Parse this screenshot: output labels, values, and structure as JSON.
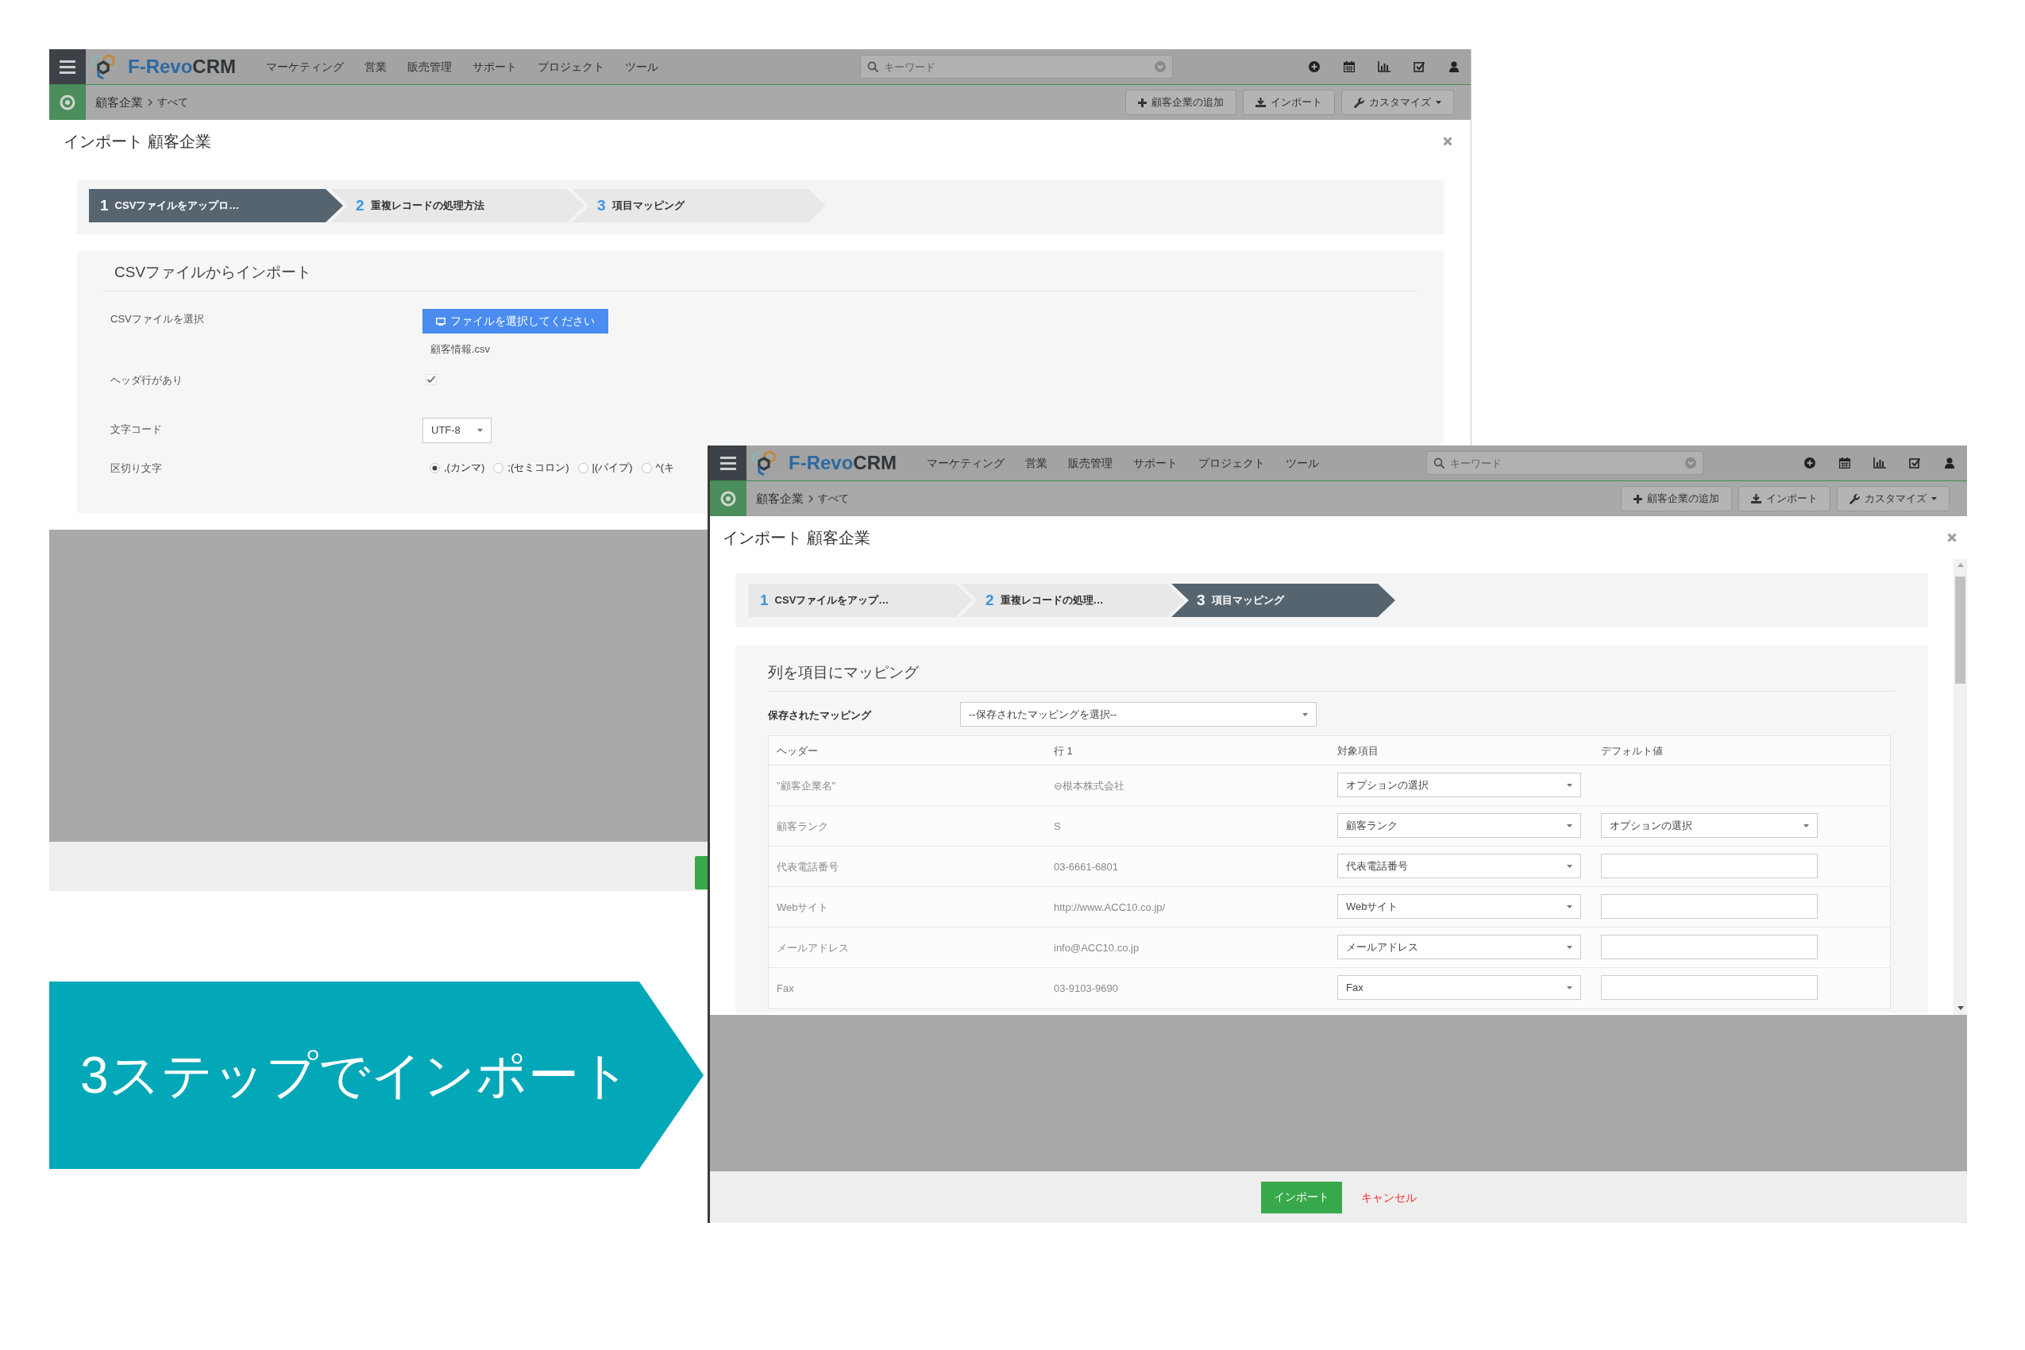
{
  "windows": [
    {
      "header": {
        "logo": {
          "brand": "F-Revo",
          "suffix": "CRM"
        },
        "menu": [
          "マーケティング",
          "営業",
          "販売管理",
          "サポート",
          "プロジェクト",
          "ツール"
        ],
        "search": {
          "placeholder": "キーワード"
        }
      },
      "breadcrumb": {
        "module": "顧客企業",
        "view": "すべて",
        "actions": [
          {
            "label": "顧客企業の追加",
            "dropdown": false
          },
          {
            "label": "インポート",
            "dropdown": false
          },
          {
            "label": "カスタマイズ",
            "dropdown": true
          }
        ]
      },
      "modal": {
        "kind": "upload",
        "title": "インポート 顧客企業",
        "steps": [
          {
            "number": "1",
            "label": "CSVファイルをアップロ…",
            "selected": true
          },
          {
            "number": "2",
            "label": "重複レコードの処理方法",
            "selected": false
          },
          {
            "number": "3",
            "label": "項目マッピング",
            "selected": false
          }
        ],
        "section_title": "CSVファイルからインポート",
        "fields": [
          {
            "kind": "file",
            "label": "CSVファイルを選択",
            "button": "ファイルを選択してください",
            "file_name": "顧客情報.csv"
          },
          {
            "kind": "checkbox",
            "label": "ヘッダ行があり",
            "checked": true
          },
          {
            "kind": "select",
            "label": "文字コード",
            "value": "UTF-8"
          },
          {
            "kind": "radio",
            "label": "区切り文字",
            "options": [
              {
                "label": ",(カンマ)",
                "selected": true
              },
              {
                "label": ";(セミコロン)",
                "selected": false
              },
              {
                "label": "|(パイプ)",
                "selected": false
              },
              {
                "label": "^(キ",
                "selected": false
              }
            ]
          }
        ]
      }
    },
    {
      "header": {
        "logo": {
          "brand": "F-Revo",
          "suffix": "CRM"
        },
        "menu": [
          "マーケティング",
          "営業",
          "販売管理",
          "サポート",
          "プロジェクト",
          "ツール"
        ],
        "search": {
          "placeholder": "キーワード"
        }
      },
      "breadcrumb": {
        "module": "顧客企業",
        "view": "すべて",
        "actions": [
          {
            "label": "顧客企業の追加",
            "dropdown": false
          },
          {
            "label": "インポート",
            "dropdown": false
          },
          {
            "label": "カスタマイズ",
            "dropdown": true
          }
        ]
      },
      "modal": {
        "kind": "mapping",
        "title": "インポート 顧客企業",
        "steps": [
          {
            "number": "1",
            "label": "CSVファイルをアップ…",
            "selected": false
          },
          {
            "number": "2",
            "label": "重複レコードの処理…",
            "selected": false
          },
          {
            "number": "3",
            "label": "項目マッピング",
            "selected": true
          }
        ],
        "section_title": "列を項目にマッピング",
        "saved_mapping": {
          "label": "保存されたマッピング",
          "value": "--保存されたマッピングを選択--"
        },
        "table": {
          "columns": [
            "ヘッダー",
            "行 1",
            "対象項目",
            "デフォルト値"
          ],
          "rows": [
            {
              "header": "\"顧客企業名\"",
              "row_1": "⊖根本株式会社",
              "target": "オプションの選択"
            },
            {
              "header": "顧客ランク",
              "row_1": "S",
              "target": "顧客ランク",
              "default": {
                "kind": "select",
                "value": "オプションの選択"
              }
            },
            {
              "header": "代表電話番号",
              "row_1": "03-6661-6801",
              "target": "代表電話番号",
              "default": {
                "kind": "input"
              }
            },
            {
              "header": "Webサイト",
              "row_1": "http://www.ACC10.co.jp/",
              "target": "Webサイト",
              "default": {
                "kind": "input"
              }
            },
            {
              "header": "メールアドレス",
              "row_1": "info@ACC10.co.jp",
              "target": "メールアドレス",
              "default": {
                "kind": "input"
              }
            },
            {
              "header": "Fax",
              "row_1": "03-9103-9690",
              "target": "Fax",
              "default": {
                "kind": "input"
              }
            }
          ]
        },
        "footer": {
          "buttons": [
            {
              "kind": "primary",
              "label": "インポート"
            },
            {
              "kind": "link",
              "label": "キャンセル"
            }
          ]
        }
      }
    }
  ],
  "callout": {
    "text": "3ステップでインポート"
  }
}
